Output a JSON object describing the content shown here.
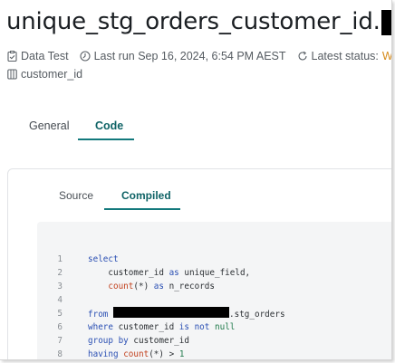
{
  "header": {
    "title": "unique_stg_orders_customer_id.",
    "resource_type": "Data Test",
    "last_run": "Last run Sep 16, 2024, 6:54 PM AEST",
    "latest_status_label": "Latest status:",
    "latest_status_value": "Warn",
    "column": "customer_id",
    "status_color": "#d58a1a"
  },
  "tabs": [
    {
      "label": "General",
      "active": false
    },
    {
      "label": "Code",
      "active": true
    }
  ],
  "subtabs": [
    {
      "label": "Source",
      "active": false
    },
    {
      "label": "Compiled",
      "active": true
    }
  ],
  "code": {
    "line_numbers": [
      "1",
      "2",
      "3",
      "4",
      "5",
      "6",
      "7",
      "8"
    ],
    "l1_kw": "select",
    "l2_ident": "customer_id",
    "l2_as": "as",
    "l2_alias": "unique_field,",
    "l3_fn": "count",
    "l3_paren": "(*)",
    "l3_as": "as",
    "l3_alias": "n_records",
    "l5_from": "from",
    "l5_table": ".stg_orders",
    "l6_where": "where",
    "l6_ident": "customer_id",
    "l6_is": "is not",
    "l6_null": "null",
    "l7_group": "group by",
    "l7_ident": "customer_id",
    "l8_having": "having",
    "l8_fn": "count",
    "l8_paren": "(*)",
    "l8_op": ">",
    "l8_num": "1"
  },
  "icons": {
    "resource_type": "clipboard-check-icon",
    "last_run": "clock-icon",
    "status": "refresh-icon",
    "column": "table-column-icon"
  },
  "colors": {
    "accent": "#13797c",
    "warn": "#d58a1a",
    "code_background": "#f4f5f6"
  }
}
